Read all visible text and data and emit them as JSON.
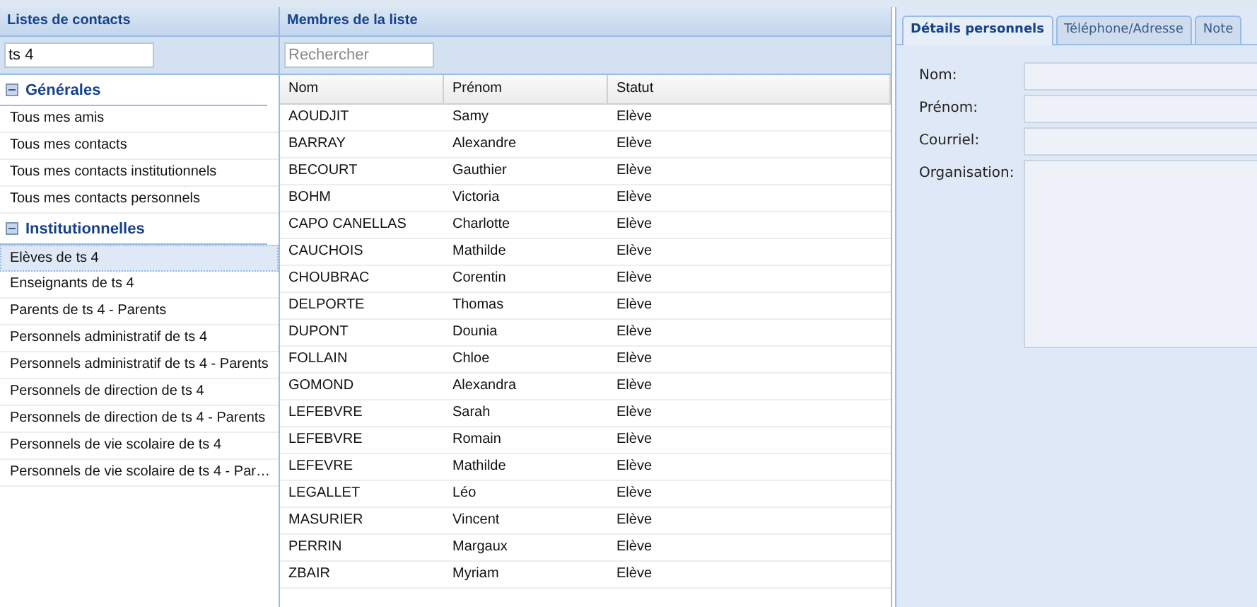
{
  "lists_panel": {
    "title": "Listes de contacts",
    "filter_value": "ts 4",
    "groups": [
      {
        "label": "Générales",
        "expanded": true,
        "items": [
          {
            "label": "Tous mes amis",
            "selected": false
          },
          {
            "label": "Tous mes contacts",
            "selected": false
          },
          {
            "label": "Tous mes contacts institutionnels",
            "selected": false
          },
          {
            "label": "Tous mes contacts personnels",
            "selected": false
          }
        ]
      },
      {
        "label": "Institutionnelles",
        "expanded": true,
        "items": [
          {
            "label": "Elèves de ts 4",
            "selected": true
          },
          {
            "label": "Enseignants de ts 4",
            "selected": false
          },
          {
            "label": "Parents de ts 4 - Parents",
            "selected": false
          },
          {
            "label": "Personnels administratif de ts 4",
            "selected": false
          },
          {
            "label": "Personnels administratif de ts 4 - Parents",
            "selected": false
          },
          {
            "label": "Personnels de direction de ts 4",
            "selected": false
          },
          {
            "label": "Personnels de direction de ts 4 - Parents",
            "selected": false
          },
          {
            "label": "Personnels de vie scolaire de ts 4",
            "selected": false
          },
          {
            "label": "Personnels de vie scolaire de ts 4 - Par…",
            "selected": false
          }
        ]
      }
    ]
  },
  "members_panel": {
    "title": "Membres de la liste",
    "search": {
      "placeholder": "Rechercher"
    },
    "table": {
      "columns": [
        "Nom",
        "Prénom",
        "Statut"
      ],
      "rows": [
        [
          "AOUDJIT",
          "Samy",
          "Elève"
        ],
        [
          "BARRAY",
          "Alexandre",
          "Elève"
        ],
        [
          "BECOURT",
          "Gauthier",
          "Elève"
        ],
        [
          "BOHM",
          "Victoria",
          "Elève"
        ],
        [
          "CAPO CANELLAS",
          "Charlotte",
          "Elève"
        ],
        [
          "CAUCHOIS",
          "Mathilde",
          "Elève"
        ],
        [
          "CHOUBRAC",
          "Corentin",
          "Elève"
        ],
        [
          "DELPORTE",
          "Thomas",
          "Elève"
        ],
        [
          "DUPONT",
          "Dounia",
          "Elève"
        ],
        [
          "FOLLAIN",
          "Chloe",
          "Elève"
        ],
        [
          "GOMOND",
          "Alexandra",
          "Elève"
        ],
        [
          "LEFEBVRE",
          "Sarah",
          "Elève"
        ],
        [
          "LEFEBVRE",
          "Romain",
          "Elève"
        ],
        [
          "LEFEVRE",
          "Mathilde",
          "Elève"
        ],
        [
          "LEGALLET",
          "Léo",
          "Elève"
        ],
        [
          "MASURIER",
          "Vincent",
          "Elève"
        ],
        [
          "PERRIN",
          "Margaux",
          "Elève"
        ],
        [
          "ZBAIR",
          "Myriam",
          "Elève"
        ]
      ]
    }
  },
  "details_panel": {
    "tabs": [
      {
        "label": "Détails personnels",
        "selected": true
      },
      {
        "label": "Téléphone/Adresse",
        "selected": false
      },
      {
        "label": "Note",
        "selected": false
      }
    ],
    "fields": [
      {
        "label": "Nom:",
        "kind": "line"
      },
      {
        "label": "Prénom:",
        "kind": "line"
      },
      {
        "label": "Courriel:",
        "kind": "line"
      },
      {
        "label": "Organisation:",
        "kind": "area"
      }
    ]
  }
}
